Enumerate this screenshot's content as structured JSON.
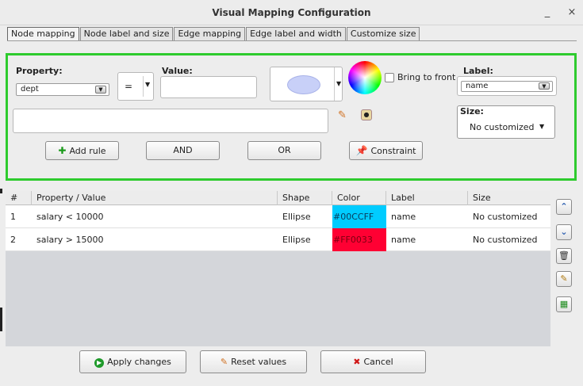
{
  "window": {
    "title": "Visual Mapping Configuration",
    "minimize": "_",
    "close": "×"
  },
  "tabs": [
    {
      "label": "Node mapping",
      "active": true
    },
    {
      "label": "Node label and size",
      "active": false
    },
    {
      "label": "Edge mapping",
      "active": false
    },
    {
      "label": "Edge label and width",
      "active": false
    },
    {
      "label": "Customize size",
      "active": false
    }
  ],
  "rule": {
    "property_label": "Property:",
    "property_value": "dept",
    "operator": "=",
    "value_label": "Value:",
    "value": "",
    "shape_preview": "ellipse",
    "bring_to_front_label": "Bring to front",
    "bring_to_front_checked": false,
    "label_label": "Label:",
    "label_value": "name",
    "size_label": "Size:",
    "size_value": "No customized",
    "expression": "",
    "buttons": {
      "add_rule": "Add rule",
      "and": "AND",
      "or": "OR",
      "constraint": "Constraint"
    }
  },
  "table": {
    "headers": [
      "#",
      "Property / Value",
      "Shape",
      "Color",
      "Label",
      "Size"
    ],
    "rows": [
      {
        "index": "1",
        "property": "salary < 10000",
        "shape": "Ellipse",
        "color": "#00CCFF",
        "label": "name",
        "size": "No customized"
      },
      {
        "index": "2",
        "property": "salary > 15000",
        "shape": "Ellipse",
        "color": "#FF0033",
        "label": "name",
        "size": "No customized"
      }
    ]
  },
  "side_buttons": [
    "move-up-icon",
    "move-down-icon",
    "delete-icon",
    "edit-icon",
    "export-icon"
  ],
  "footer": {
    "apply": "Apply changes",
    "reset": "Reset values",
    "cancel": "Cancel"
  },
  "colors": {
    "panel_border": "#2ECB2E",
    "row1_color": "#00CCFF",
    "row2_color": "#FF0033",
    "preview_fill": "#C8D0F8"
  }
}
